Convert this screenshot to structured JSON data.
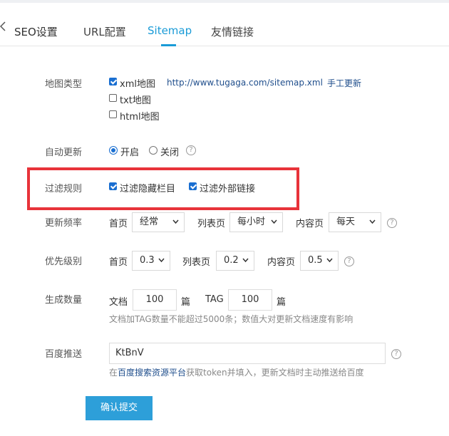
{
  "header": {
    "title": "SEO设置",
    "tabs": [
      {
        "label": "URL配置"
      },
      {
        "label": "Sitemap"
      },
      {
        "label": "友情链接"
      }
    ]
  },
  "map_type": {
    "label": "地图类型",
    "xml": {
      "label": "xml地图",
      "checked": true,
      "url": "http://www.tugaga.com/sitemap.xml",
      "manual_update": "手工更新"
    },
    "txt": {
      "label": "txt地图",
      "checked": false
    },
    "html": {
      "label": "html地图",
      "checked": false
    }
  },
  "auto_update": {
    "label": "自动更新",
    "on": {
      "label": "开启",
      "checked": true
    },
    "off": {
      "label": "关闭",
      "checked": false
    }
  },
  "filter_rules": {
    "label": "过滤规则",
    "hide_columns": {
      "label": "过滤隐藏栏目",
      "checked": true
    },
    "external_links": {
      "label": "过滤外部链接",
      "checked": true
    }
  },
  "frequency": {
    "label": "更新频率",
    "home": {
      "label": "首页",
      "value": "经常"
    },
    "list": {
      "label": "列表页",
      "value": "每小时"
    },
    "content": {
      "label": "内容页",
      "value": "每天"
    }
  },
  "priority": {
    "label": "优先级别",
    "home": {
      "label": "首页",
      "value": "0.3"
    },
    "list": {
      "label": "列表页",
      "value": "0.2"
    },
    "content": {
      "label": "内容页",
      "value": "0.5"
    }
  },
  "generate_count": {
    "label": "生成数量",
    "doc_label": "文档",
    "doc_value": "100",
    "unit": "篇",
    "tag_label": "TAG",
    "tag_value": "100",
    "tag_unit": "篇",
    "hint": "文档加TAG数量不能超过5000条；数值大对更新文档速度有影响"
  },
  "baidu_push": {
    "label": "百度推送",
    "token_value": "KtBnV",
    "hint_prefix": "在",
    "hint_link": "百度搜索资源平台",
    "hint_suffix": "获取token并填入，更新文档时主动推送给百度"
  },
  "submit_label": "确认提交"
}
